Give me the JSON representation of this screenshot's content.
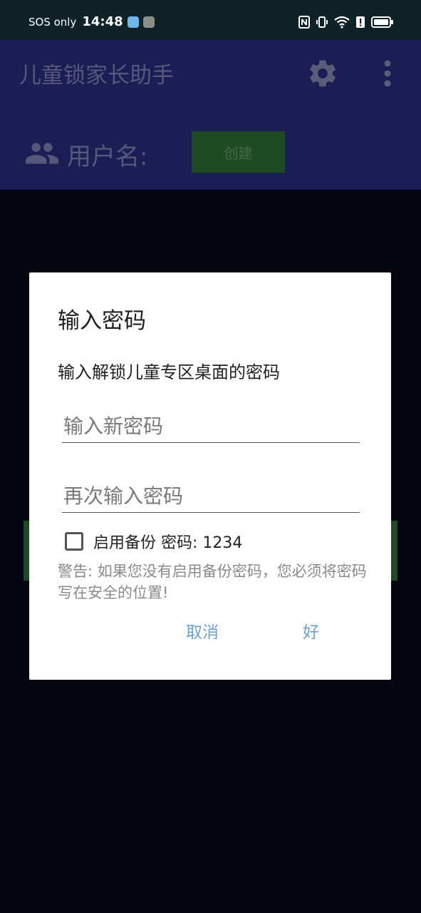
{
  "status_bar": {
    "carrier": "SOS only",
    "time": "14:48",
    "icons": [
      "nfc-icon",
      "vibrate-icon",
      "wifi-icon",
      "alert-icon",
      "battery-icon"
    ],
    "colors": {
      "background": "#0e2228"
    }
  },
  "app_bar": {
    "title": "儿童锁家长助手",
    "settings_icon": "gear-icon",
    "menu_icon": "more-vert-icon",
    "colors": {
      "background": "#1b1d54"
    }
  },
  "user_section": {
    "icon": "people-icon",
    "label": "用户名:",
    "create_button": "创建",
    "colors": {
      "button": "#1f4b23"
    }
  },
  "dialog": {
    "title": "输入密码",
    "message": "输入解锁儿童专区桌面的密码",
    "new_password_placeholder": "输入新密码",
    "confirm_password_placeholder": "再次输入密码",
    "backup_checkbox_label": "启用备份 密码: 1234",
    "backup_checked": false,
    "warning": "警告: 如果您没有启用备份密码，您必须将密码写在安全的位置!",
    "cancel_label": "取消",
    "ok_label": "好",
    "colors": {
      "action": "#6aa1d8",
      "background": "#ffffff"
    }
  }
}
